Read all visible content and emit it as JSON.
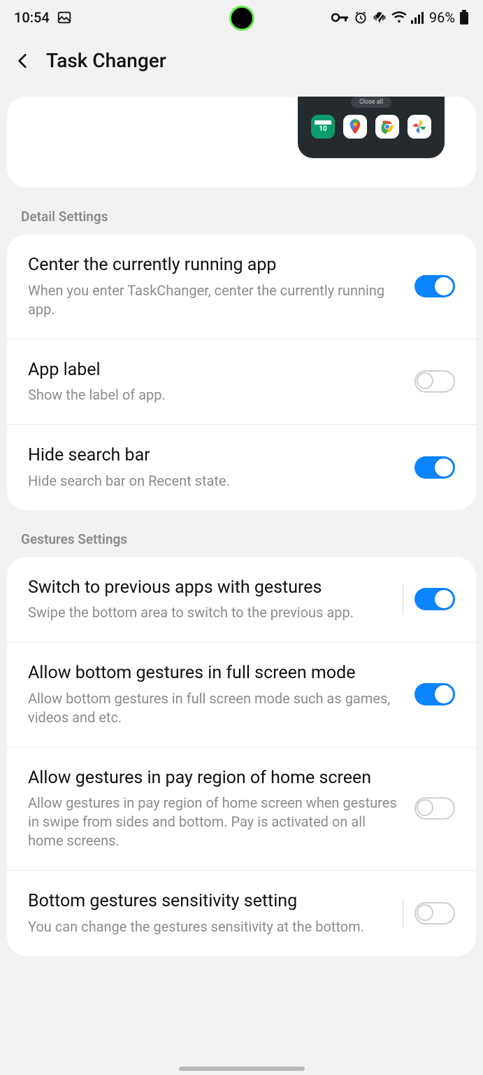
{
  "status": {
    "time": "10:54",
    "battery": "96%"
  },
  "header": {
    "title": "Task Changer"
  },
  "preview": {
    "close_all": "Close all",
    "calendar_day": "10"
  },
  "sections": {
    "detail_label": "Detail Settings",
    "gestures_label": "Gestures Settings"
  },
  "detail": [
    {
      "title": "Center the currently running app",
      "desc": "When you enter TaskChanger, center the currently running app.",
      "on": true
    },
    {
      "title": "App label",
      "desc": "Show the label of app.",
      "on": false
    },
    {
      "title": "Hide search bar",
      "desc": "Hide search bar on Recent state.",
      "on": true
    }
  ],
  "gestures": [
    {
      "title": "Switch to previous apps with gestures",
      "desc": "Swipe the bottom area to switch to the previous app.",
      "on": true,
      "divider": true
    },
    {
      "title": "Allow bottom gestures in full screen mode",
      "desc": "Allow bottom gestures in full screen mode such as games, videos and etc.",
      "on": true
    },
    {
      "title": "Allow gestures in pay region of home screen",
      "desc": "Allow gestures in pay region of home screen when gestures in swipe from sides and bottom. Pay is activated on all home screens.",
      "on": false
    },
    {
      "title": "Bottom gestures sensitivity setting",
      "desc": "You can change the gestures sensitivity at the bottom.",
      "on": false,
      "divider": true
    }
  ]
}
